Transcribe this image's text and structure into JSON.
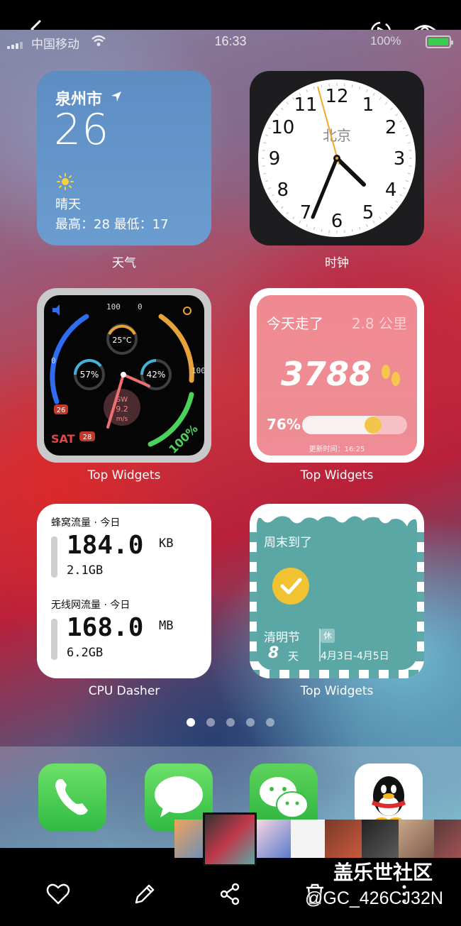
{
  "statusbar": {
    "carrier": "中国移动",
    "time": "16:33",
    "battery": "100%"
  },
  "widgets": {
    "weather": {
      "city": "泉州市",
      "temp": "26",
      "condition": "晴天",
      "range": "最高：28 最低：17",
      "app_label": "天气"
    },
    "clock": {
      "city": "北京",
      "numbers": [
        "12",
        "1",
        "2",
        "3",
        "4",
        "5",
        "6",
        "7",
        "8",
        "9",
        "10",
        "11"
      ],
      "app_label": "时钟"
    },
    "watch": {
      "top_left": "100",
      "top_right": "0",
      "left_num": "0",
      "right_num": "100",
      "temp": "25°C",
      "left_pct": "57%",
      "right_pct": "42%",
      "wind_dir": "SW",
      "wind_speed": "9.2",
      "wind_unit": "m/s",
      "day_num": "26",
      "weekday": "SAT",
      "date_num": "28",
      "battery_pct": "100%",
      "app_label": "Top Widgets"
    },
    "steps": {
      "title": "今天走了",
      "distance": "2.8 公里",
      "count": "3788",
      "percent": "76%",
      "progress": 0.76,
      "updated": "更新时间：16:25",
      "app_label": "Top Widgets"
    },
    "cpu": {
      "cell_header": "蜂窝流量 · 今日",
      "cell_value": "184.0",
      "cell_unit": "KB",
      "cell_total": "2.1GB",
      "wifi_header": "无线网流量 · 今日",
      "wifi_value": "168.0",
      "wifi_unit": "MB",
      "wifi_total": "6.2GB",
      "app_label": "CPU Dasher"
    },
    "holiday": {
      "title": "周末到了",
      "name": "清明节",
      "days": "8",
      "days_unit": "天",
      "badge": "休",
      "dates": "4月3日-4月5日",
      "app_label": "Top Widgets"
    }
  },
  "page_dots": {
    "count": 5,
    "active": 1
  },
  "dock": [
    "phone-icon",
    "messages-icon",
    "wechat-icon",
    "qq-icon"
  ],
  "watermark": {
    "site": "盖乐世社区",
    "user": "@GC_426CJ32N"
  },
  "toolbar": [
    "heart-icon",
    "edit-icon",
    "share-icon",
    "delete-icon",
    "more-icon"
  ],
  "colors": {
    "weather_bg": "#5d8ec3",
    "steps_bg": "#f08a91",
    "holiday_bg": "#5aa7a5",
    "clock_second_hand": "#f5a623"
  }
}
